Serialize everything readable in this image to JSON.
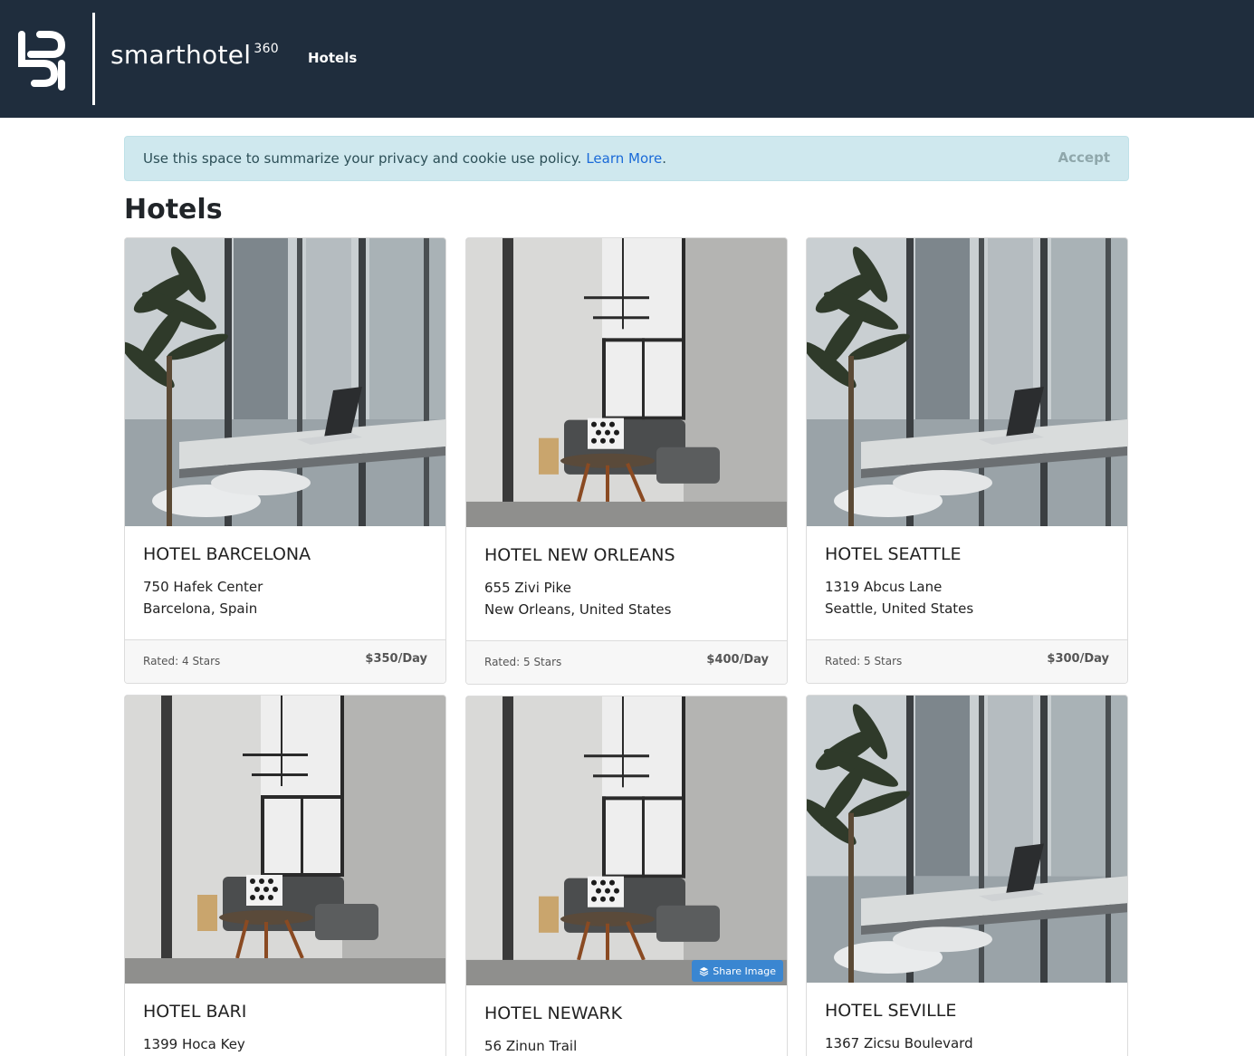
{
  "nav": {
    "brand": "smarthotel",
    "brand_sup": "360",
    "link_hotels": "Hotels"
  },
  "cookie": {
    "message": "Use this space to summarize your privacy and cookie use policy.",
    "learn_more": "Learn More",
    "period": ".",
    "accept": "Accept"
  },
  "page": {
    "title": "Hotels"
  },
  "hotels": [
    {
      "name": "HOTEL BARCELONA",
      "address": "750 Hafek Center",
      "city": "Barcelona, Spain",
      "rated": "Rated: 4 Stars",
      "price": "$350/Day",
      "image": "office-window-photo"
    },
    {
      "name": "HOTEL NEW ORLEANS",
      "address": "655 Zivi Pike",
      "city": "New Orleans, United States",
      "rated": "Rated: 5 Stars",
      "price": "$400/Day",
      "image": "living-room-photo"
    },
    {
      "name": "HOTEL SEATTLE",
      "address": "1319 Abcus Lane",
      "city": "Seattle, United States",
      "rated": "Rated: 5 Stars",
      "price": "$300/Day",
      "image": "office-window-photo"
    },
    {
      "name": "HOTEL BARI",
      "address": "1399 Hoca Key",
      "image": "living-room-photo"
    },
    {
      "name": "HOTEL NEWARK",
      "address": "56 Zinun Trail",
      "image": "living-room-photo",
      "share_label": "Share Image"
    },
    {
      "name": "HOTEL SEVILLE",
      "address": "1367 Zicsu Boulevard",
      "image": "office-window-photo"
    }
  ]
}
